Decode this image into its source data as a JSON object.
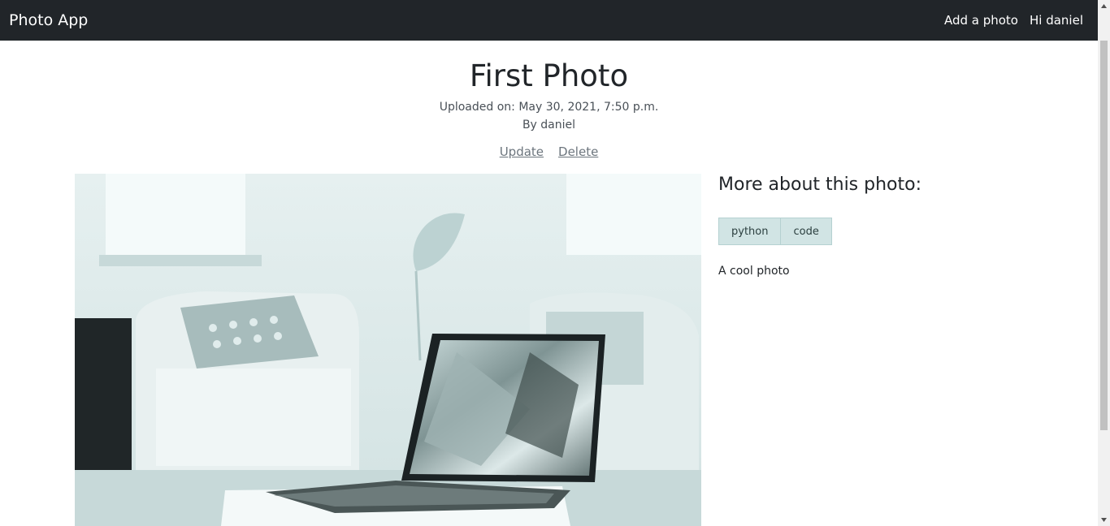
{
  "nav": {
    "brand": "Photo App",
    "add_photo": "Add a photo",
    "greeting": "Hi daniel"
  },
  "photo": {
    "title": "First Photo",
    "uploaded": "Uploaded on: May 30, 2021, 7:50 p.m.",
    "author": "By daniel",
    "actions": {
      "update": "Update",
      "delete": "Delete"
    },
    "image_alt": "laptop on coffee table in living room"
  },
  "sidebar": {
    "heading": "More about this photo:",
    "tags": [
      "python",
      "code"
    ],
    "description": "A cool photo"
  },
  "colors": {
    "navbar": "#212529",
    "tag_bg": "#d1e4e4",
    "link": "#6c757d"
  },
  "icons": {
    "scroll_up": "triangle-up-icon",
    "scroll_down": "triangle-down-icon"
  }
}
